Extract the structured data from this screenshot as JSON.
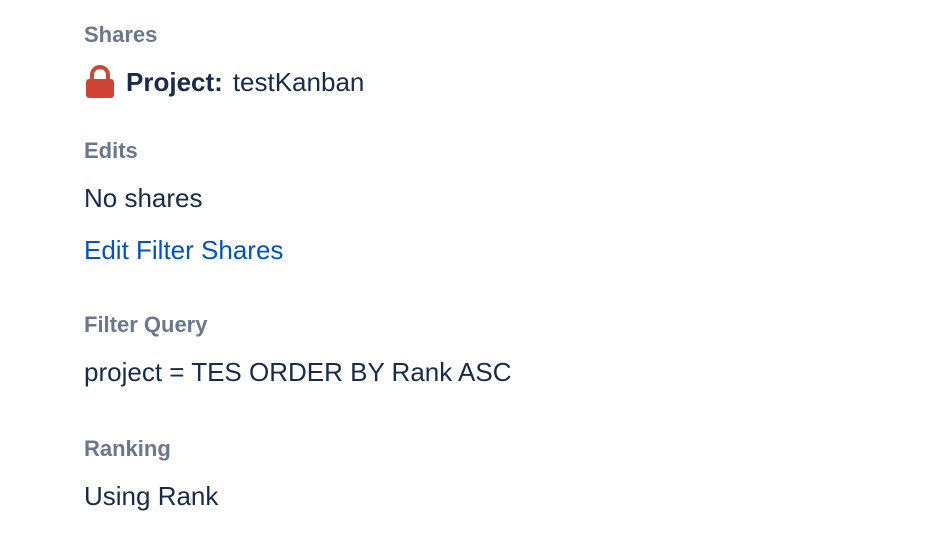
{
  "shares": {
    "label": "Shares",
    "items": [
      {
        "icon": "lock-icon",
        "type": "Project:",
        "name": "testKanban",
        "icon_color": "#d04437"
      }
    ]
  },
  "edits": {
    "label": "Edits",
    "value": "No shares",
    "edit_link": "Edit Filter Shares"
  },
  "filter_query": {
    "label": "Filter Query",
    "value": "project = TES ORDER BY Rank ASC"
  },
  "ranking": {
    "label": "Ranking",
    "value": "Using Rank"
  },
  "colors": {
    "label": "#6b778c",
    "text": "#172b4d",
    "link": "#0052cc",
    "lock": "#d04437"
  }
}
